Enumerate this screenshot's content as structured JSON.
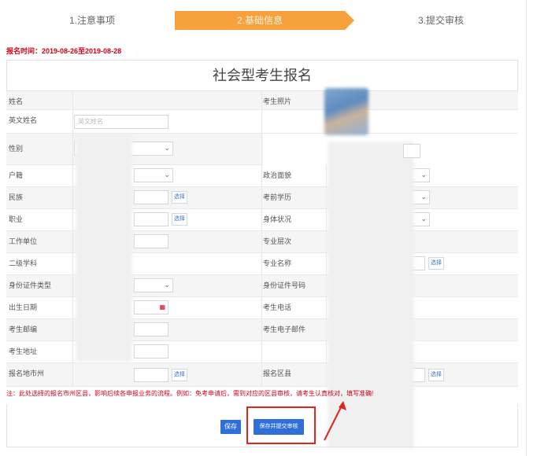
{
  "steps": [
    {
      "label": "1.注意事项"
    },
    {
      "label": "2.基础信息"
    },
    {
      "label": "3.提交审核"
    }
  ],
  "registration_time": "报名时间：2019-08-26至2019-08-28",
  "form_title": "社会型考生报名",
  "fields": {
    "name": "姓名",
    "english_name": "英文姓名",
    "english_name_placeholder": "英文姓名",
    "photo": "考生照片",
    "gender": "性别",
    "household": "户籍",
    "political": "政治面貌",
    "ethnicity": "民族",
    "education": "考前学历",
    "occupation": "职业",
    "health": "身体状况",
    "employer": "工作单位",
    "major_level": "专业层次",
    "secondary_discipline": "二级学科",
    "major_name": "专业名称",
    "id_type": "身份证件类型",
    "id_number": "身份证件号码",
    "birth_date": "出生日期",
    "phone": "考生电话",
    "postal_code": "考生邮编",
    "email": "考生电子邮件",
    "address": "考生地址",
    "reg_city": "报名地市州",
    "reg_district": "报名区县",
    "choose": "选择"
  },
  "note": "注：此处选择的报名市州区县，影响后续各申报业务的流程。例如：免考申请后，需到对应的区县审核，请考生认真核对，填写准确!",
  "buttons": {
    "save": "保存",
    "save_submit": "保存并提交审核"
  },
  "colors": {
    "active_step": "#f7a13c",
    "primary": "#2f6fd6",
    "highlight": "#e0261a",
    "warning_text": "#d0021b"
  }
}
